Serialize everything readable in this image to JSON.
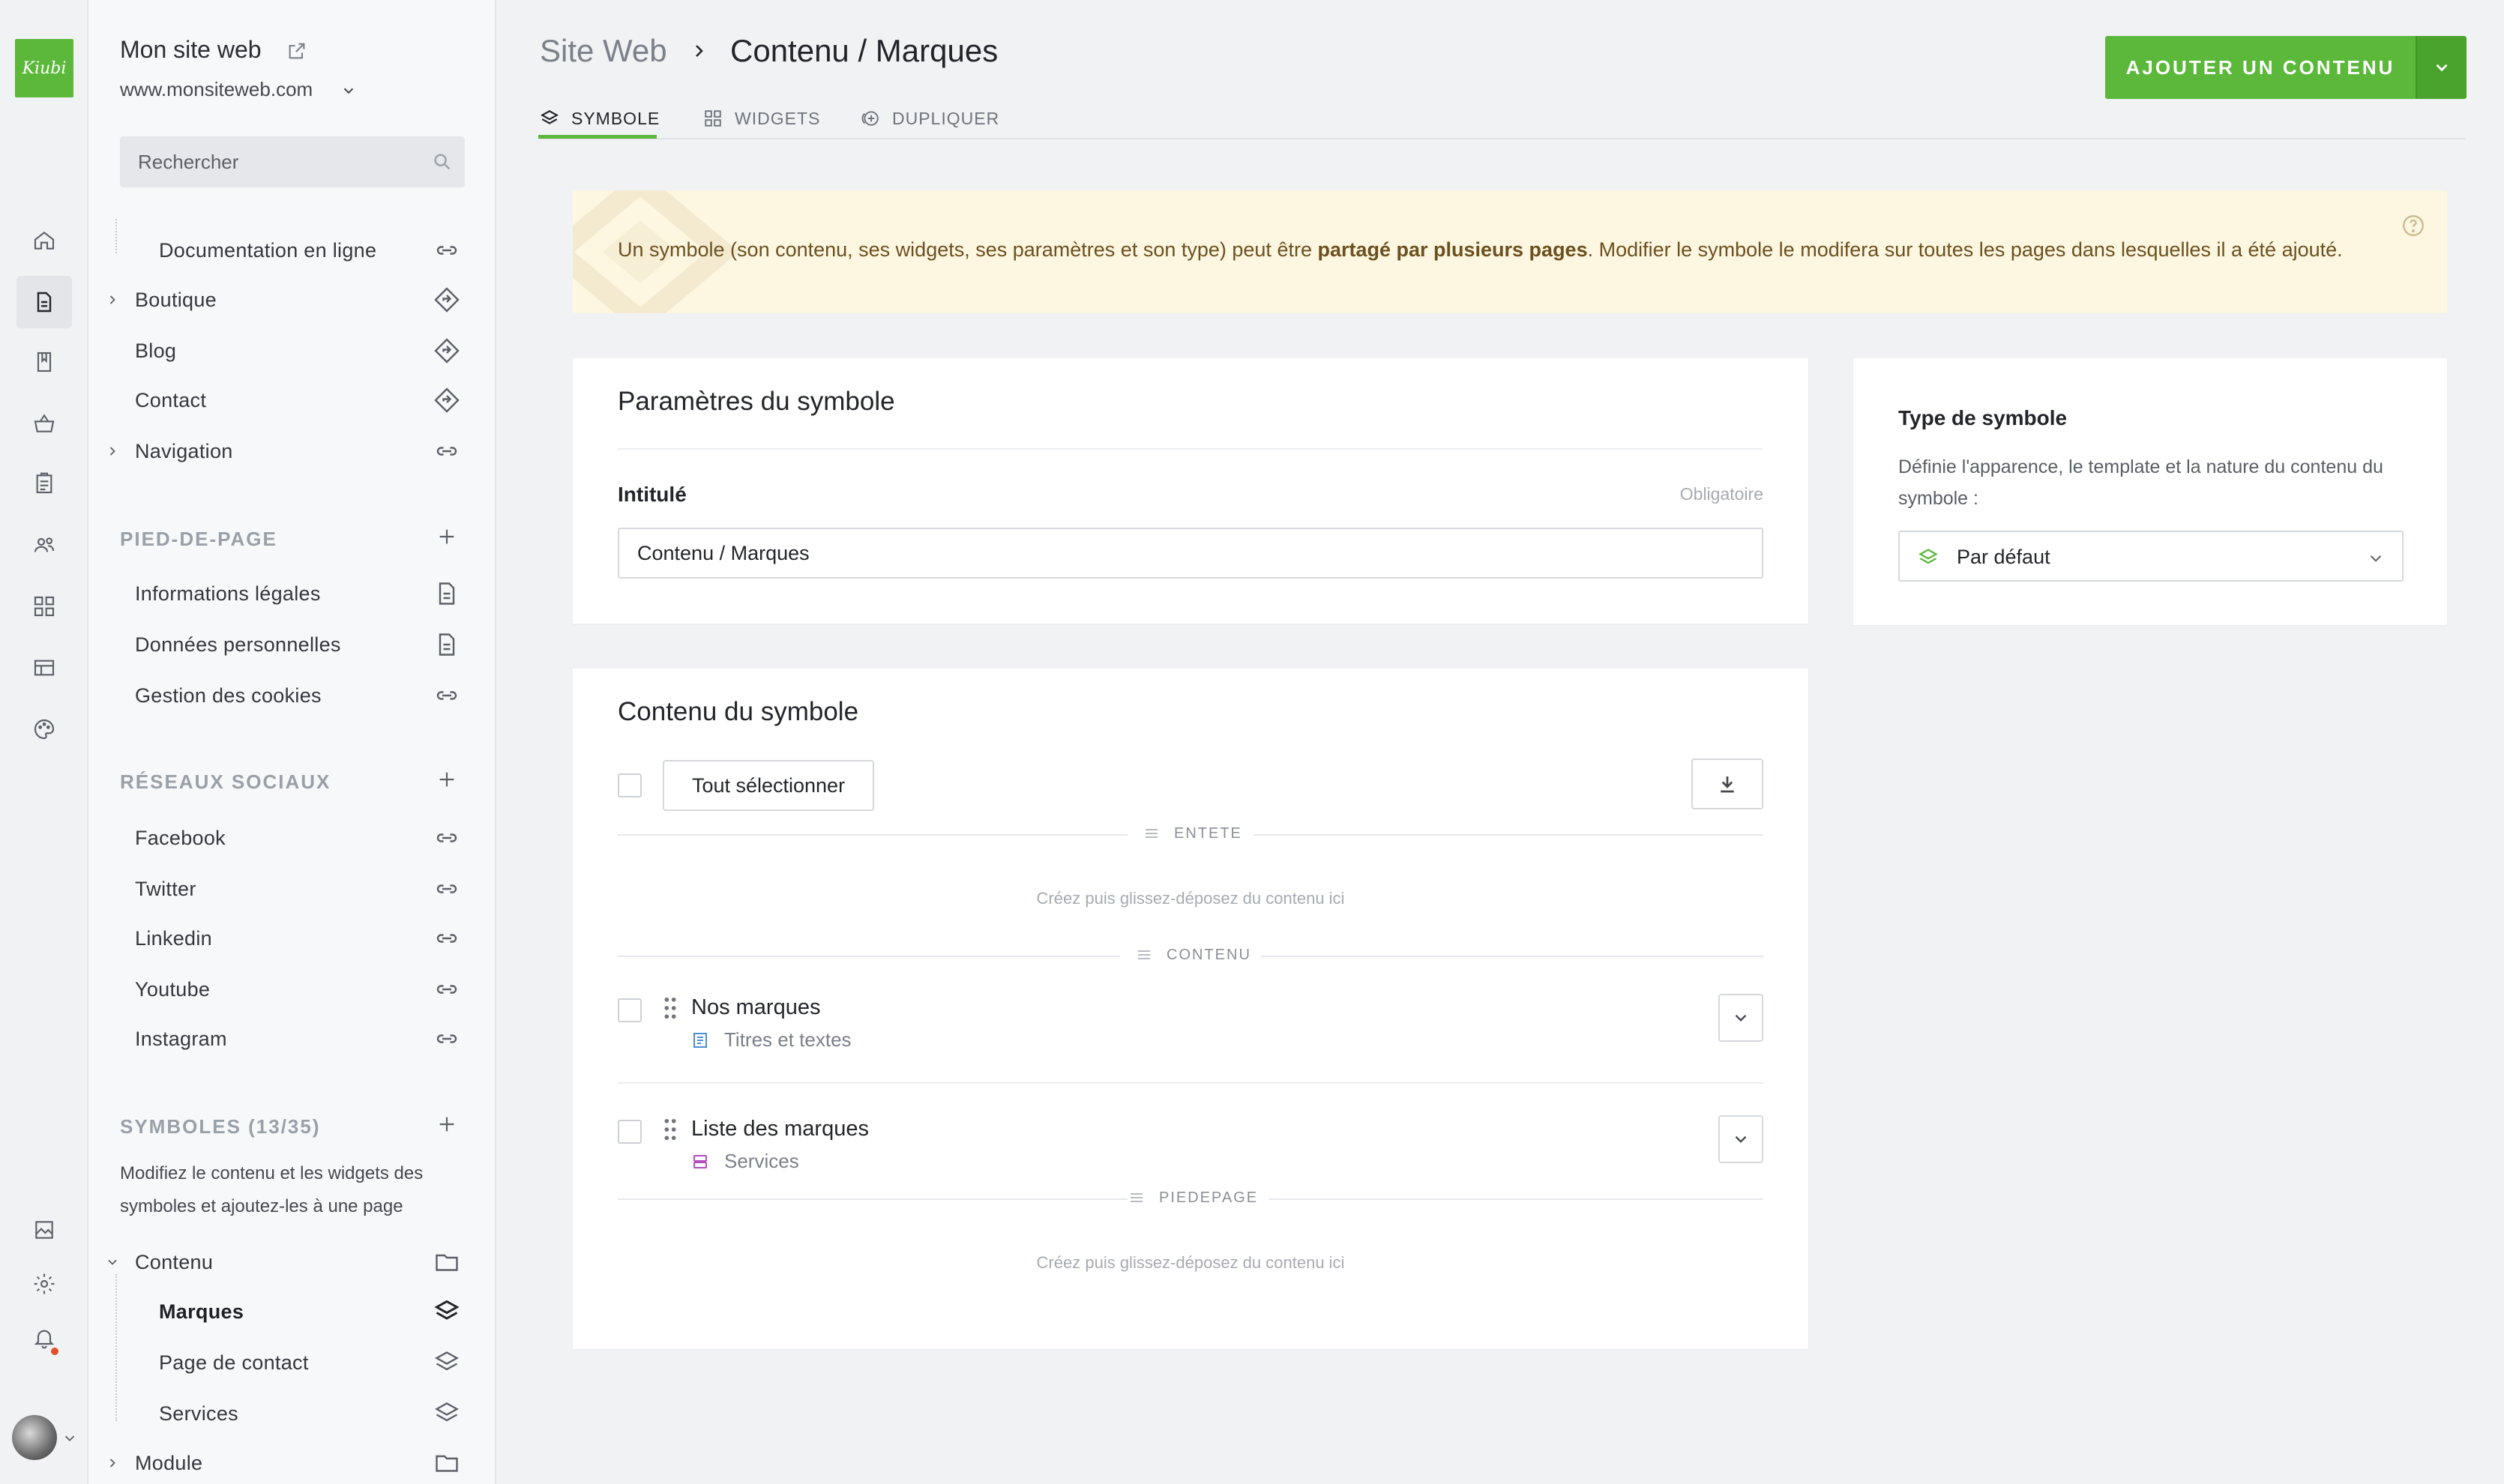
{
  "app": {
    "logo_text": "Kiubi"
  },
  "colors": {
    "accent": "#5bb83a",
    "info_bg": "#fdf6e0",
    "notification": "#e2502b"
  },
  "rail": {
    "items": [
      {
        "icon": "home-icon"
      },
      {
        "icon": "pages-icon",
        "active": true
      },
      {
        "icon": "bookmark-icon"
      },
      {
        "icon": "basket-icon"
      },
      {
        "icon": "clipboard-icon"
      },
      {
        "icon": "users-icon"
      },
      {
        "icon": "widgets-icon"
      },
      {
        "icon": "layout-icon"
      },
      {
        "icon": "palette-icon"
      }
    ],
    "bottom": [
      {
        "icon": "media-icon"
      },
      {
        "icon": "settings-icon"
      },
      {
        "icon": "bell-icon"
      }
    ]
  },
  "sidebar": {
    "site_title": "Mon site web",
    "site_url": "www.monsiteweb.com",
    "search_placeholder": "Rechercher",
    "main_items": [
      {
        "label": "Documentation en ligne",
        "icon": "link-icon"
      },
      {
        "label": "Boutique",
        "icon": "direction-icon"
      },
      {
        "label": "Blog",
        "icon": "direction-icon"
      },
      {
        "label": "Contact",
        "icon": "direction-icon"
      },
      {
        "label": "Navigation",
        "icon": "link-icon"
      }
    ],
    "footer_section": "PIED-DE-PAGE",
    "footer_items": [
      {
        "label": "Informations légales",
        "icon": "document-icon"
      },
      {
        "label": "Données personnelles",
        "icon": "document-icon"
      },
      {
        "label": "Gestion des cookies",
        "icon": "link-icon"
      }
    ],
    "social_section": "RÉSEAUX SOCIAUX",
    "social_items": [
      {
        "label": "Facebook",
        "icon": "link-icon"
      },
      {
        "label": "Twitter",
        "icon": "link-icon"
      },
      {
        "label": "Linkedin",
        "icon": "link-icon"
      },
      {
        "label": "Youtube",
        "icon": "link-icon"
      },
      {
        "label": "Instagram",
        "icon": "link-icon"
      }
    ],
    "symbols_section": "SYMBOLES (13/35)",
    "symbols_desc": "Modifiez le contenu et les widgets des symboles et ajoutez-les à une page",
    "symbol_tree": [
      {
        "label": "Contenu",
        "icon": "folder-icon"
      },
      {
        "label": "Marques",
        "icon": "layers-icon"
      },
      {
        "label": "Page de contact",
        "icon": "layers-icon"
      },
      {
        "label": "Services",
        "icon": "layers-icon"
      },
      {
        "label": "Module",
        "icon": "folder-icon"
      }
    ]
  },
  "header": {
    "breadcrumb_root": "Site Web",
    "breadcrumb_current": "Contenu / Marques",
    "tabs": [
      {
        "label": "SYMBOLE",
        "icon": "layers-icon"
      },
      {
        "label": "WIDGETS",
        "icon": "widgets-icon"
      },
      {
        "label": "DUPLIQUER",
        "icon": "duplicate-icon"
      }
    ],
    "add_button": "AJOUTER UN CONTENU"
  },
  "info": {
    "text_before": "Un symbole (son contenu, ses widgets, ses paramètres et son type) peut être ",
    "text_bold": "partagé par plusieurs pages",
    "text_after": ". Modifier le symbole le modifera sur toutes les pages dans lesquelles il a été ajouté."
  },
  "params": {
    "title": "Paramètres du symbole",
    "field_label": "Intitulé",
    "field_required": "Obligatoire",
    "field_value": "Contenu / Marques"
  },
  "type_card": {
    "title": "Type de symbole",
    "description": "Définie l'apparence, le template et la nature du contenu du symbole :",
    "selected": "Par défaut"
  },
  "content": {
    "title": "Contenu du symbole",
    "select_all": "Tout sélectionner",
    "zones": {
      "header": "ENTETE",
      "content": "CONTENU",
      "footer": "PIEDEPAGE"
    },
    "drop_hint": "Créez puis glissez-déposez du contenu ici",
    "rows": [
      {
        "title": "Nos marques",
        "type": "Titres et textes",
        "type_icon": "text-block-icon",
        "type_color": "#4a8fd6"
      },
      {
        "title": "Liste des marques",
        "type": "Services",
        "type_icon": "list-block-icon",
        "type_color": "#b44bbf"
      }
    ]
  }
}
